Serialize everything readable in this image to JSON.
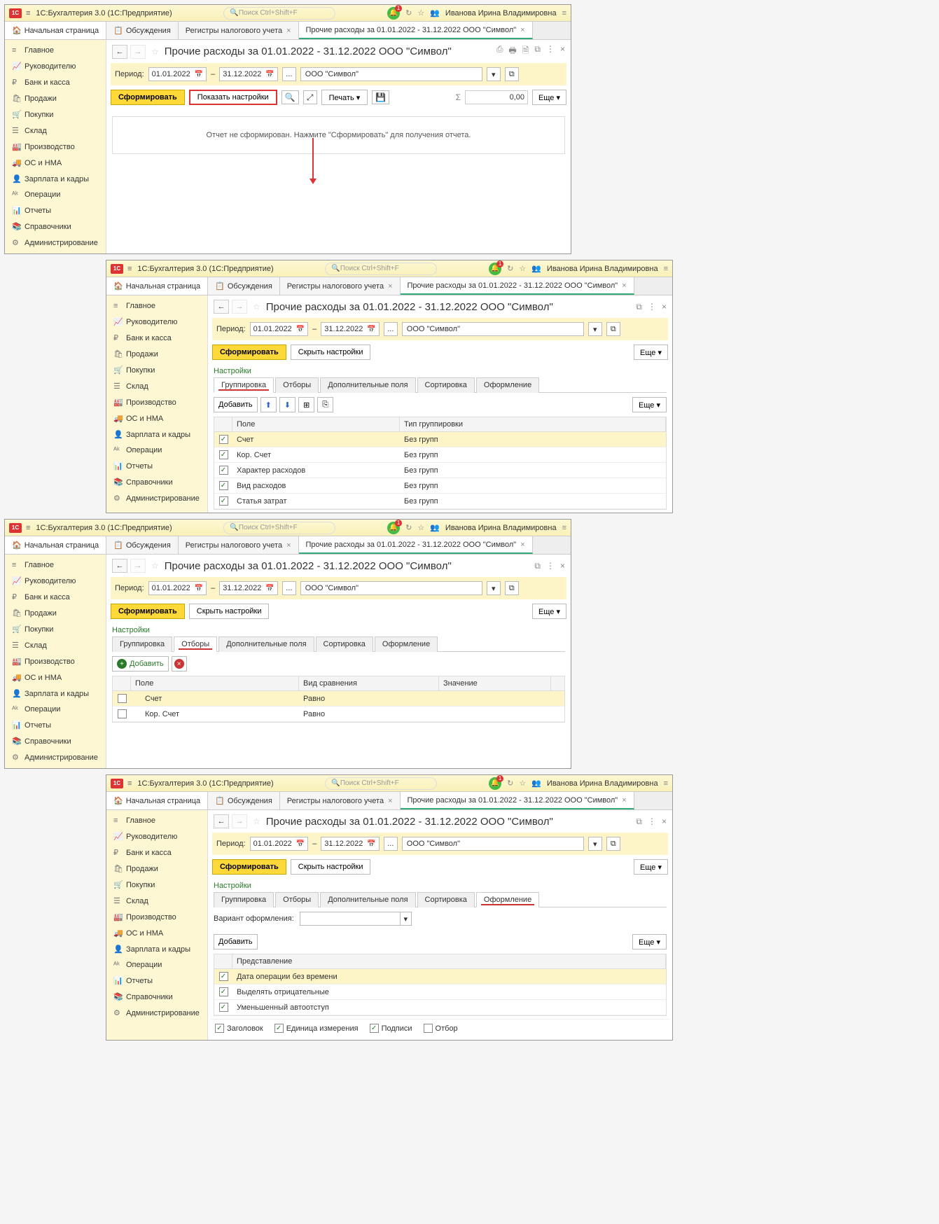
{
  "common": {
    "logo": "1C",
    "burger": "≡",
    "app_title": "1С:Бухгалтерия 3.0  (1С:Предприятие)",
    "search_placeholder": "Поиск Ctrl+Shift+F",
    "user": "Иванова Ирина Владимировна",
    "tabs": {
      "home": "Начальная страница",
      "discussions": "Обсуждения",
      "registers": "Регистры налогового учета",
      "report": "Прочие расходы за 01.01.2022 - 31.12.2022 ООО \"Символ\""
    },
    "sidebar": [
      "Главное",
      "Руководителю",
      "Банк и касса",
      "Продажи",
      "Покупки",
      "Склад",
      "Производство",
      "ОС и НМА",
      "Зарплата и кадры",
      "Операции",
      "Отчеты",
      "Справочники",
      "Администрирование"
    ],
    "sidebar_icons": [
      "≡",
      "📈",
      "₽",
      "🛍",
      "🛒",
      "☰",
      "🏭",
      "🚚",
      "👤",
      "ᴬᵏ",
      "📊",
      "📚",
      "⚙"
    ],
    "page_title": "Прочие расходы за 01.01.2022 - 31.12.2022 ООО \"Символ\"",
    "period_label": "Период:",
    "date_from": "01.01.2022",
    "date_to": "31.12.2022",
    "dash": "–",
    "dots": "...",
    "org": "ООО \"Символ\"",
    "form_btn": "Сформировать",
    "show_settings": "Показать настройки",
    "hide_settings": "Скрыть настройки",
    "print_btn": "Печать",
    "sum_icon": "Σ",
    "sum_val": "0,00",
    "more_btn": "Еще",
    "settings_label": "Настройки",
    "add_btn": "Добавить",
    "tabs2": [
      "Группировка",
      "Отборы",
      "Дополнительные поля",
      "Сортировка",
      "Оформление"
    ]
  },
  "win1": {
    "report_msg": "Отчет не сформирован. Нажмите \"Сформировать\" для получения отчета."
  },
  "win2": {
    "grid_head": {
      "field": "Поле",
      "type": "Тип группировки"
    },
    "rows": [
      {
        "checked": true,
        "field": "Счет",
        "type": "Без групп",
        "sel": true
      },
      {
        "checked": true,
        "field": "Кор. Счет",
        "type": "Без групп"
      },
      {
        "checked": true,
        "field": "Характер расходов",
        "type": "Без групп"
      },
      {
        "checked": true,
        "field": "Вид расходов",
        "type": "Без групп"
      },
      {
        "checked": true,
        "field": "Статья затрат",
        "type": "Без групп"
      }
    ]
  },
  "win3": {
    "grid_head": {
      "field": "Поле",
      "comp": "Вид сравнения",
      "val": "Значение"
    },
    "rows": [
      {
        "checked": false,
        "field": "Счет",
        "comp": "Равно",
        "val": "",
        "sel": true
      },
      {
        "checked": false,
        "field": "Кор. Счет",
        "comp": "Равно",
        "val": ""
      }
    ]
  },
  "win4": {
    "variant_label": "Вариант оформления:",
    "grid_head": {
      "repr": "Представление"
    },
    "rows": [
      {
        "checked": true,
        "repr": "Дата операции без времени",
        "sel": true
      },
      {
        "checked": true,
        "repr": "Выделять отрицательные"
      },
      {
        "checked": true,
        "repr": "Уменьшенный автоотступ"
      }
    ],
    "footer": [
      {
        "checked": true,
        "label": "Заголовок"
      },
      {
        "checked": true,
        "label": "Единица измерения"
      },
      {
        "checked": true,
        "label": "Подписи"
      },
      {
        "checked": false,
        "label": "Отбор"
      }
    ]
  }
}
